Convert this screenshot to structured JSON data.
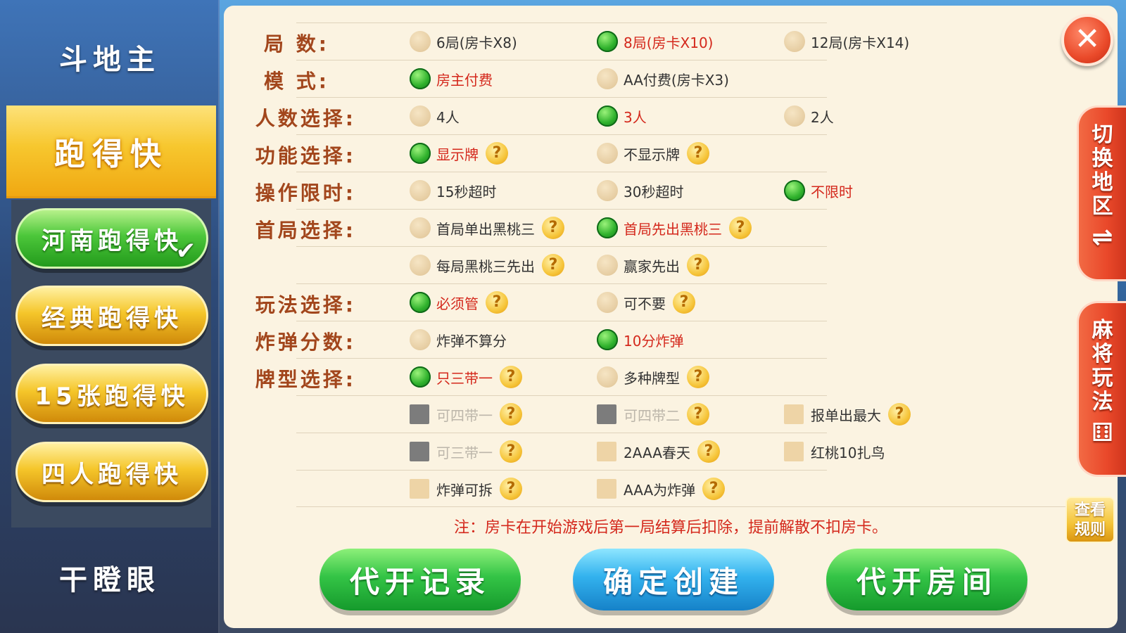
{
  "sidebar": {
    "top_item": "斗地主",
    "active_item": "跑得快",
    "sub_items": [
      {
        "label": "河南跑得快",
        "selected": true
      },
      {
        "label": "经典跑得快",
        "selected": false
      },
      {
        "label": "15张跑得快",
        "selected": false
      },
      {
        "label": "四人跑得快",
        "selected": false
      }
    ],
    "bottom_item": "干瞪眼"
  },
  "rows": {
    "rounds": {
      "label": "局  数:",
      "options": [
        {
          "text": "6局(房卡X8)",
          "on": false
        },
        {
          "text": "8局(房卡X10)",
          "on": true
        },
        {
          "text": "12局(房卡X14)",
          "on": false
        }
      ]
    },
    "mode": {
      "label": "模  式:",
      "options": [
        {
          "text": "房主付费",
          "on": true
        },
        {
          "text": "AA付费(房卡X3)",
          "on": false
        }
      ]
    },
    "players": {
      "label": "人数选择:",
      "options": [
        {
          "text": "4人",
          "on": false
        },
        {
          "text": "3人",
          "on": true
        },
        {
          "text": "2人",
          "on": false
        }
      ]
    },
    "feature": {
      "label": "功能选择:",
      "options": [
        {
          "text": "显示牌",
          "on": true
        },
        {
          "text": "不显示牌",
          "on": false
        }
      ]
    },
    "timer": {
      "label": "操作限时:",
      "options": [
        {
          "text": "15秒超时",
          "on": false
        },
        {
          "text": "30秒超时",
          "on": false
        },
        {
          "text": "不限时",
          "on": true
        }
      ]
    },
    "first": {
      "label": "首局选择:",
      "options": [
        {
          "text": "首局单出黑桃三",
          "on": false
        },
        {
          "text": "首局先出黑桃三",
          "on": true
        },
        {
          "text": "每局黑桃三先出",
          "on": false
        },
        {
          "text": "赢家先出",
          "on": false
        }
      ]
    },
    "play": {
      "label": "玩法选择:",
      "options": [
        {
          "text": "必须管",
          "on": true
        },
        {
          "text": "可不要",
          "on": false
        }
      ]
    },
    "bomb": {
      "label": "炸弹分数:",
      "options": [
        {
          "text": "炸弹不算分",
          "on": false
        },
        {
          "text": "10分炸弹",
          "on": true
        }
      ]
    },
    "cardtype": {
      "label": "牌型选择:",
      "options": [
        {
          "text": "只三带一",
          "on": true
        },
        {
          "text": "多种牌型",
          "on": false
        }
      ]
    }
  },
  "checkboxes": [
    {
      "text": "可四带一",
      "disabled": true
    },
    {
      "text": "可四带二",
      "disabled": true
    },
    {
      "text": "报单出最大",
      "disabled": false
    },
    {
      "text": "可三带一",
      "disabled": true
    },
    {
      "text": "2AAA春天",
      "disabled": false
    },
    {
      "text": "红桃10扎鸟",
      "disabled": false
    },
    {
      "text": "炸弹可拆",
      "disabled": false
    },
    {
      "text": "AAA为炸弹",
      "disabled": false
    }
  ],
  "help_glyph": "?",
  "note": "注：房卡在开始游戏后第一局结算后扣除，提前解散不扣房卡。",
  "buttons": {
    "record": "代开记录",
    "create": "确定创建",
    "proxy_room": "代开房间"
  },
  "close_glyph": "✕",
  "right_tabs": {
    "switch_region": "切换地区",
    "switch_glyph": "⇌",
    "mahjong": "麻将玩法",
    "dice_glyph": "⚅",
    "rules": "查看规则"
  },
  "colors": {
    "label": "#a2461c",
    "selected_text": "#d4281c",
    "panel_bg": "#fbf3e1"
  }
}
